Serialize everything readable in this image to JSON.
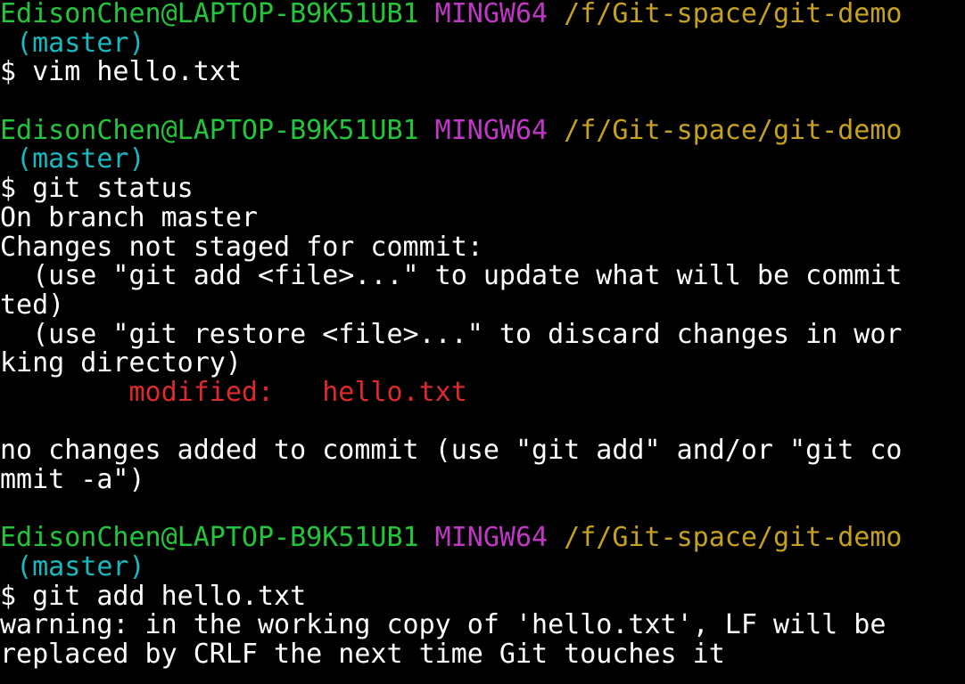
{
  "terminal": {
    "blocks": [
      {
        "prompt": {
          "user": "EdisonChen@LAPTOP-B9K51UB1",
          "env": "MINGW64",
          "path": "/f/Git-space/git-demo",
          "branch": "(master)"
        },
        "command": "$ vim hello.txt",
        "output": []
      },
      {
        "prompt": {
          "user": "EdisonChen@LAPTOP-B9K51UB1",
          "env": "MINGW64",
          "path": "/f/Git-space/git-demo",
          "branch": "(master)"
        },
        "command": "$ git status",
        "output": [
          "On branch master",
          "Changes not staged for commit:",
          "  (use \"git add <file>...\" to update what will be commit",
          "ted)",
          "  (use \"git restore <file>...\" to discard changes in wor",
          "king directory)"
        ],
        "modified_label": "modified:",
        "modified_file": "hello.txt",
        "footer": [
          "no changes added to commit (use \"git add\" and/or \"git co",
          "mmit -a\")"
        ]
      },
      {
        "prompt": {
          "user": "EdisonChen@LAPTOP-B9K51UB1",
          "env": "MINGW64",
          "path": "/f/Git-space/git-demo",
          "branch": "(master)"
        },
        "command": "$ git add hello.txt",
        "output": [
          "warning: in the working copy of 'hello.txt', LF will be",
          "replaced by CRLF the next time Git touches it"
        ]
      }
    ]
  },
  "colors": {
    "user": "#23c53a",
    "env": "#c037c6",
    "path": "#c6a11d",
    "branch": "#18b9bf",
    "modified": "#dd2a2d",
    "text": "#ffffff",
    "background": "#000000"
  }
}
